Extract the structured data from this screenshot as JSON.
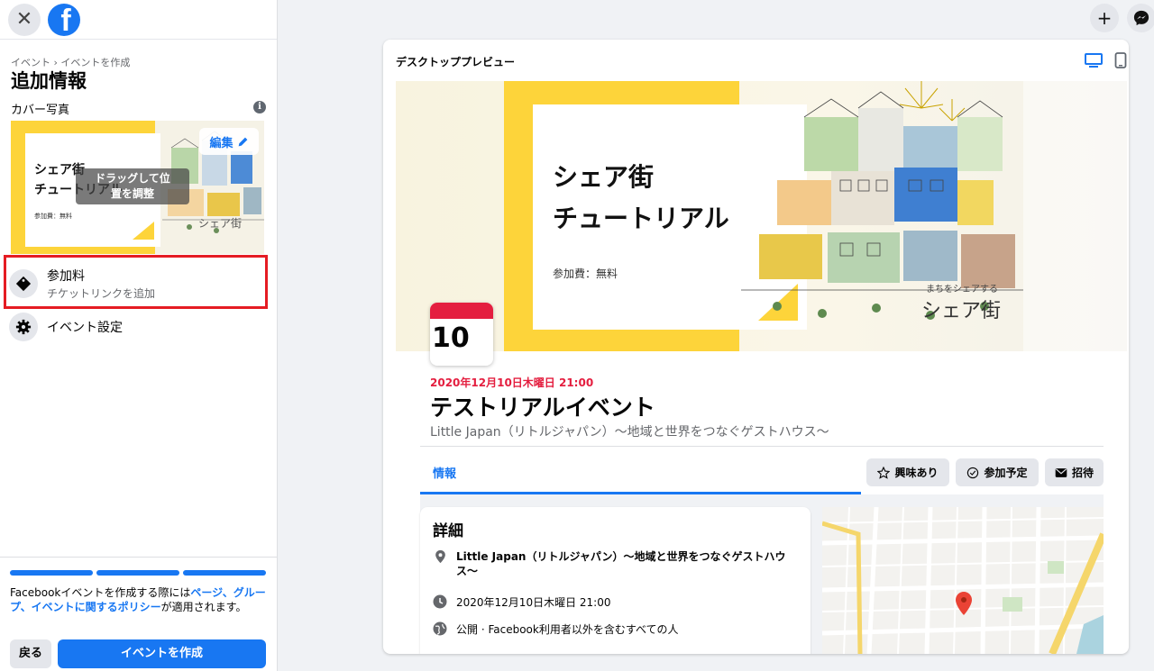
{
  "sidebar": {
    "close_icon": "close-icon",
    "logo_glyph": "f",
    "breadcrumb": [
      "イベント",
      "›",
      "イベントを作成"
    ],
    "title": "追加情報",
    "cover_label": "カバー写真",
    "info_glyph": "i",
    "cover": {
      "title": "シェア街\nチュートリアル",
      "fee": "参加費：無料",
      "drag_hint": "ドラッグして位\n置を調整",
      "edit_label": "編集"
    },
    "options": [
      {
        "label": "参加料",
        "sub": "チケットリンクを追加",
        "icon": "ticket-icon"
      },
      {
        "label": "イベント設定",
        "icon": "gear-icon"
      }
    ],
    "progress_steps": 3,
    "policy_text_1": "Facebookイベントを作成する際には",
    "policy_link": "ページ、グループ、イベントに関するポリシー",
    "policy_text_2": "が適用されます。",
    "back_label": "戻る",
    "create_label": "イベントを作成"
  },
  "topbar": {
    "plus_glyph": "+",
    "messenger_icon": "messenger-icon"
  },
  "preview": {
    "label": "デスクトッププレビュー",
    "desktop_icon": "desktop-icon",
    "mobile_icon": "mobile-icon",
    "banner": {
      "title": "シェア街\nチュートリアル",
      "fee": "参加費：無料"
    },
    "calendar_day": "10",
    "date_line": "2020年12月10日木曜日 21:00",
    "event_title": "テストリアルイベント",
    "place": "Little Japan（リトルジャパン）〜地域と世界をつなぐゲストハウス〜",
    "tab_label": "情報",
    "actions": [
      {
        "label": "興味あり",
        "icon": "star-icon"
      },
      {
        "label": "参加予定",
        "icon": "check-circle-icon"
      },
      {
        "label": "招待",
        "icon": "envelope-icon"
      }
    ],
    "details": {
      "title": "詳細",
      "location": "Little Japan（リトルジャパン）〜地域と世界をつなぐゲストハウス〜",
      "datetime": "2020年12月10日木曜日 21:00",
      "privacy": "公開 · Facebook利用者以外を含むすべての人"
    }
  },
  "colors": {
    "accent": "#1877f2",
    "highlight": "#e51c23",
    "date_red": "#e41e3f",
    "banner_yellow": "#fdd43a"
  }
}
